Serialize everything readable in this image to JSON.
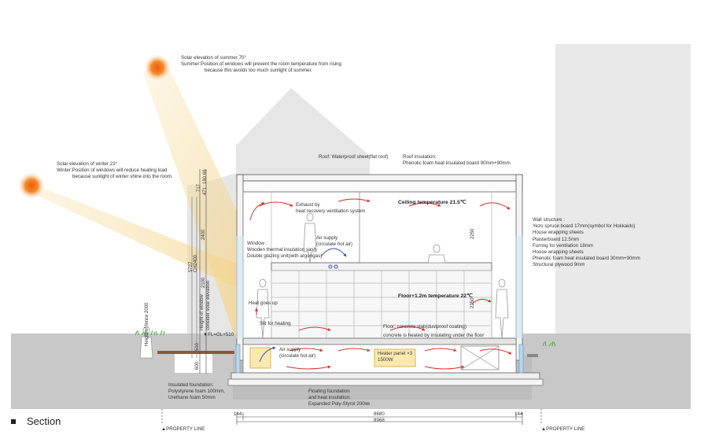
{
  "caption": {
    "label": "Section"
  },
  "sun": {
    "summer": {
      "title": "Solar elevation of  summer 70°",
      "line1": "Summer:Position of windows will prevent the room temperature from rising",
      "line2": "because this avoids too much sunlight of summer."
    },
    "winter": {
      "title": "Solar elevation of winter 23°",
      "line1": "Winter:Position of windows will reduce heating load",
      "line2": "because sunlight of winter shine into the room."
    }
  },
  "roof": {
    "waterproof": "Roof: Waterproof sheet(flat roof)",
    "insulation_title": "Roof insulation:",
    "insulation_detail": "Phenolic foam heat insulated board 90mm+90mm"
  },
  "interior": {
    "exhaust_1": "Exhaust by",
    "exhaust_2": "heat recovery ventilation system",
    "ceiling_temp": "Ceiling temperature 21.5℃",
    "window_1": "Window :",
    "window_2": "Wooden thermal insulation sash",
    "window_3": "Double glazing unit(with argongas)",
    "air_supply_top_1": "Air supply",
    "air_supply_top_2": "(circulate hot air)",
    "floor_temp": "Floor+1.2m temperature 22℃",
    "heat_goes_up": "Heat goes up",
    "slit": "Slit for heating",
    "floor_1": "Floor: concrete slab(dustproof coating)",
    "floor_2": "concrete is heated by insulating under the floor",
    "air_supply_bottom_1": "Air supply",
    "air_supply_bottom_2": "(circulate hot air)",
    "heater_1": "Heater panel ×3",
    "heater_2": "1500W"
  },
  "wall": {
    "title": "Wall structure :",
    "items": [
      "Yezo spruce board  17mm(symbol for Hokkaido)",
      "House wrapping sheets",
      "Plasterboard 12.5mm",
      "Furring for ventilation 18mm",
      "House wrapping sheets",
      "Phenolic foam heat insulated board 30mm+90mm",
      "Structural plywood 9mm"
    ]
  },
  "foundation": {
    "insulated_1": "Insulated foundation:",
    "insulated_2": "Polystyrene foam 100mm,",
    "insulated_3": "Urethane foam 50mm",
    "floating_1": "Floating foundation",
    "floating_2": "and heat insulation:",
    "floating_3": "Expanded Poly-Styrol  200㎜"
  },
  "dimensions": {
    "d144_left": "144",
    "d8680": "8680",
    "d144_right": "144",
    "d8968": "8968",
    "property_left": "▲PROPERTY LINE",
    "property_right": "▲PROPERTY  LINE",
    "v66": "66",
    "v180": "180",
    "v471": "471",
    "v717": "717",
    "v2400": "2400",
    "v5727": "5727",
    "vCH2400": "CH2400",
    "v2100": "2100",
    "v510": "510",
    "v600": "600",
    "v2250_top": "2250",
    "v2250_bottom": "2250",
    "height_window_1": "Height of window",
    "height_window_2": "consider solar elevation",
    "height_fence": "Height of fence 2000",
    "fl": "▼FL=GL+510"
  },
  "colors": {
    "sun": "#f07a1a",
    "sun_beam": "#f6d99a",
    "warm_air": "#d8302a",
    "supply_air": "#3a50b0",
    "ground": "#c9c9c9",
    "building_bg": "#e9e9e9",
    "grass": "#44aa33",
    "heater": "#fde9b0"
  }
}
